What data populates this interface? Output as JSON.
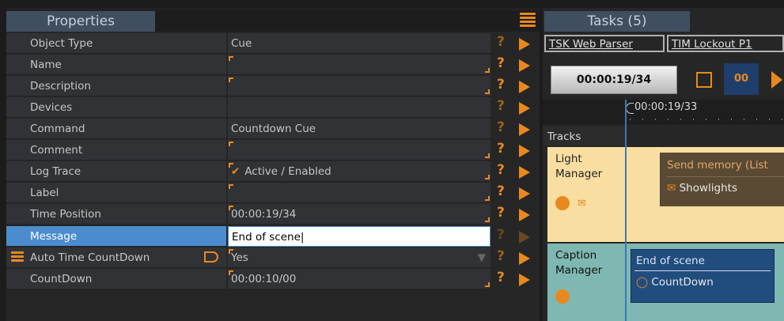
{
  "properties": {
    "tab_title": "Properties",
    "rows": [
      {
        "label": "Object Type",
        "value": ""
      },
      {
        "label": "Name",
        "value": ""
      },
      {
        "label": "Description",
        "value": ""
      },
      {
        "label": "Devices",
        "value": ""
      },
      {
        "label": "Command",
        "value": "Countdown Cue"
      },
      {
        "label": "Comment",
        "value": ""
      },
      {
        "label": "Log Trace",
        "value": "Active / Enabled"
      },
      {
        "label": "Label",
        "value": ""
      },
      {
        "label": "Time Position",
        "value": "00:00:19/34"
      },
      {
        "label": "Message",
        "value": "End of scene"
      },
      {
        "label": "Auto Time CountDown",
        "value": "Yes"
      },
      {
        "label": "CountDown",
        "value": "00:00:10/00"
      }
    ],
    "object_type_value": "Cue",
    "help_glyph": "?",
    "colors": {
      "accent": "#e8891f",
      "selection": "#4a8ccd"
    }
  },
  "tasks": {
    "tab_title": "Tasks (5)",
    "task_tabs": [
      "TSK Web Parser",
      "TIM Lockout P1"
    ],
    "time": "00:00:19/34",
    "pause_label": "00",
    "ruler_time": "00:00:19/33",
    "tracks_label": "Tracks",
    "tracks": [
      {
        "name": "Light Manager",
        "clip_title": "Send memory (List",
        "clip_sub": "Showlights"
      },
      {
        "name": "Caption Manager",
        "clip_title": "End of scene",
        "clip_sub": "CountDown"
      }
    ]
  }
}
